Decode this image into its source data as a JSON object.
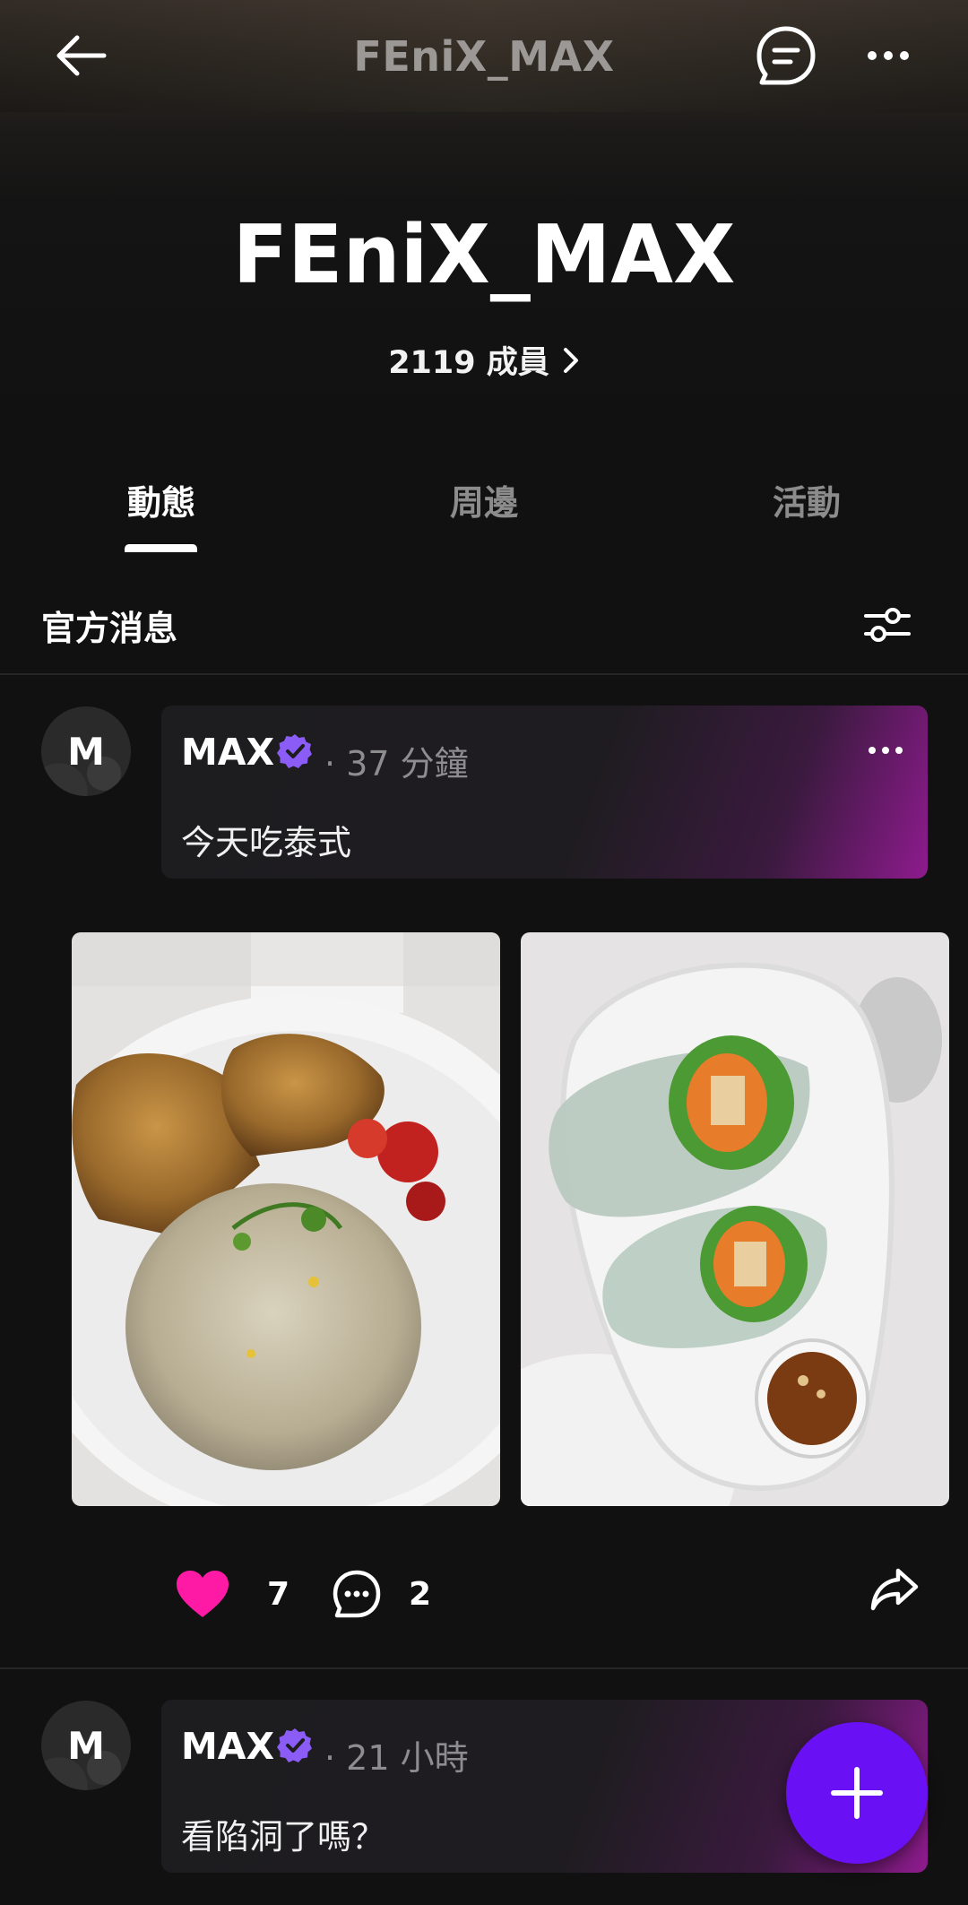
{
  "header": {
    "title": "FEniX_MAX",
    "back_icon": "arrow-left-icon",
    "chat_icon": "chat-bubble-icon",
    "more_icon": "more-horizontal-icon"
  },
  "group": {
    "name": "FEniX_MAX",
    "members_label": "2119 成員"
  },
  "tabs": [
    {
      "label": "動態",
      "active": true
    },
    {
      "label": "周邊",
      "active": false
    },
    {
      "label": "活動",
      "active": false
    }
  ],
  "section": {
    "title": "官方消息",
    "filter_icon": "sliders-icon"
  },
  "posts": [
    {
      "avatar_letter": "M",
      "author": "MAX",
      "time": "· 37 分鐘",
      "text": "今天吃泰式",
      "images": [
        "chicken-fried-rice-photo",
        "spring-rolls-photo"
      ],
      "likes": "7",
      "comments": "2"
    },
    {
      "avatar_letter": "M",
      "author": "MAX",
      "time": "· 21 小時",
      "text": "看陷洞了嗎？"
    }
  ],
  "colors": {
    "accent_purple": "#6a10f5",
    "heart_pink": "#ff1aa6",
    "verified": "#8b5cf6",
    "background": "#111112"
  },
  "fab": {
    "icon": "plus-icon"
  }
}
